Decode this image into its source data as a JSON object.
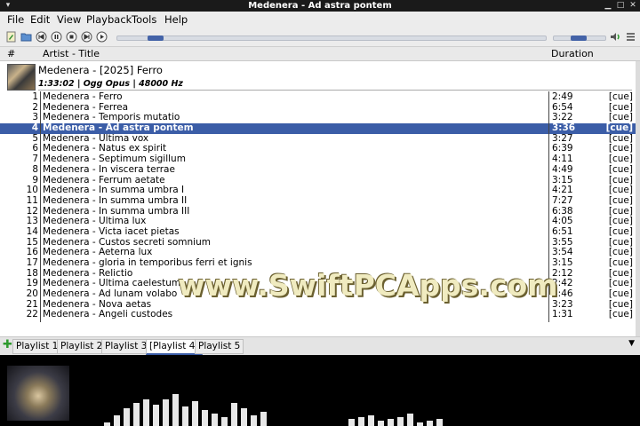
{
  "window": {
    "title": "Medenera - Ad astra pontem"
  },
  "menu": {
    "file": "File",
    "edit": "Edit",
    "view": "View",
    "playback": "Playback",
    "tools": "Tools",
    "help": "Help"
  },
  "columns": {
    "num": "#",
    "artist_title": "Artist - Title",
    "duration": "Duration"
  },
  "album": {
    "title": "Medenera - [2025] Ferro",
    "info": "1:33:02 | Ogg Opus | 48000 Hz"
  },
  "tracks": [
    {
      "n": "1",
      "t": "Medenera - Ferro",
      "d": "2:49",
      "c": "[cue]"
    },
    {
      "n": "2",
      "t": "Medenera - Ferrea",
      "d": "6:54",
      "c": "[cue]"
    },
    {
      "n": "3",
      "t": "Medenera - Temporis mutatio",
      "d": "3:22",
      "c": "[cue]"
    },
    {
      "n": "4",
      "t": "Medenera - Ad astra pontem",
      "d": "3:36",
      "c": "[cue]"
    },
    {
      "n": "5",
      "t": "Medenera - Ultima vox",
      "d": "3:27",
      "c": "[cue]"
    },
    {
      "n": "6",
      "t": "Medenera - Natus ex spirit",
      "d": "6:39",
      "c": "[cue]"
    },
    {
      "n": "7",
      "t": "Medenera - Septimum sigillum",
      "d": "4:11",
      "c": "[cue]"
    },
    {
      "n": "8",
      "t": "Medenera - In viscera terrae",
      "d": "4:49",
      "c": "[cue]"
    },
    {
      "n": "9",
      "t": "Medenera - Ferrum aetate",
      "d": "3:15",
      "c": "[cue]"
    },
    {
      "n": "10",
      "t": "Medenera - In summa umbra I",
      "d": "4:21",
      "c": "[cue]"
    },
    {
      "n": "11",
      "t": "Medenera - In summa umbra II",
      "d": "7:27",
      "c": "[cue]"
    },
    {
      "n": "12",
      "t": "Medenera - In summa umbra III",
      "d": "6:38",
      "c": "[cue]"
    },
    {
      "n": "13",
      "t": "Medenera - Ultima lux",
      "d": "4:05",
      "c": "[cue]"
    },
    {
      "n": "14",
      "t": "Medenera - Victa iacet pietas",
      "d": "6:51",
      "c": "[cue]"
    },
    {
      "n": "15",
      "t": "Medenera - Custos secreti somnium",
      "d": "3:55",
      "c": "[cue]"
    },
    {
      "n": "16",
      "t": "Medenera - Aeterna lux",
      "d": "3:54",
      "c": "[cue]"
    },
    {
      "n": "17",
      "t": "Medenera - gloria in temporibus ferri et ignis",
      "d": "3:15",
      "c": "[cue]"
    },
    {
      "n": "18",
      "t": "Medenera - Relictio",
      "d": "2:12",
      "c": "[cue]"
    },
    {
      "n": "19",
      "t": "Medenera - Ultima caelestum",
      "d": "2:42",
      "c": "[cue]"
    },
    {
      "n": "20",
      "t": "Medenera - Ad lunam volabo",
      "d": "3:46",
      "c": "[cue]"
    },
    {
      "n": "21",
      "t": "Medenera - Nova aetas",
      "d": "3:23",
      "c": "[cue]"
    },
    {
      "n": "22",
      "t": "Medenera - Angeli custodes",
      "d": "1:31",
      "c": "[cue]"
    }
  ],
  "selected_track": 4,
  "tabs": [
    "Playlist 1",
    "Playlist 2",
    "Playlist 3",
    "[Playlist 4]",
    "Playlist 5"
  ],
  "active_tab": 3,
  "seek_position": 0.07,
  "volume_level": 0.4,
  "watermark": "www.SwiftPCApps.com",
  "colors": {
    "selection": "#3b5da7",
    "accent": "#4463a8",
    "titlebar": "#1a1a1a"
  },
  "icons": [
    "new-playlist-icon",
    "open-folder-icon",
    "previous-icon",
    "pause-icon",
    "stop-icon",
    "next-icon",
    "play-icon",
    "volume-icon",
    "equalizer-icon"
  ]
}
